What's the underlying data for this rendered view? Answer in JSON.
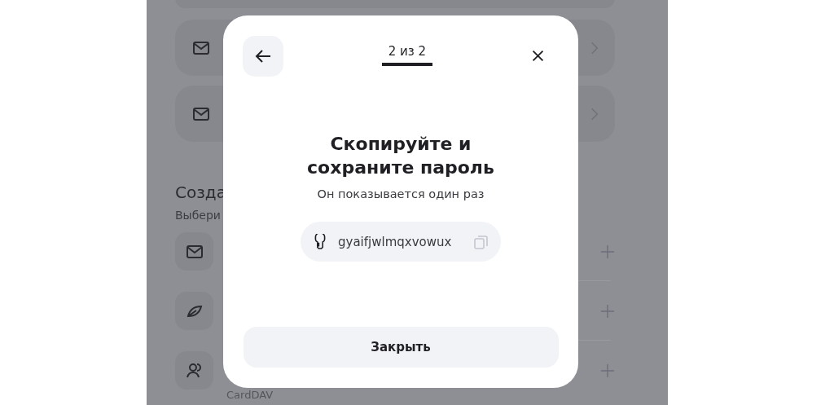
{
  "background": {
    "cards": [
      {
        "kind": "partial"
      },
      {
        "kind": "mail"
      },
      {
        "kind": "mail"
      }
    ],
    "section_title": "Созда",
    "section_subtitle": "Выбери",
    "rows": [
      {
        "kind": "mail"
      },
      {
        "kind": "leaf"
      },
      {
        "kind": "contacts",
        "subtitle": "CardDAV"
      }
    ]
  },
  "dialog": {
    "step": "2 из 2",
    "title": "Скопируйте и сохраните пароль",
    "subtitle": "Он показывается один раз",
    "password": "gyaifjwlmqxvowux",
    "button": "Закрыть"
  }
}
